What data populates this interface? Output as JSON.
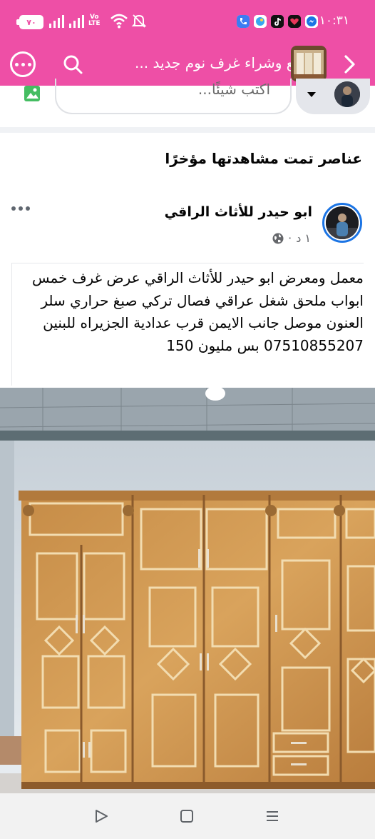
{
  "status_bar": {
    "time": "١٠:٣١",
    "battery": "٧٠",
    "network": "Vo LTE",
    "network_line1": "Vo",
    "network_line2": "LTE"
  },
  "app_bar": {
    "title": "بيع وشراء غرف نوم جديد ...",
    "more_icon": "more-horizontal-circle-icon",
    "search_icon": "search-icon",
    "back_icon": "chevron-right-icon"
  },
  "composer": {
    "placeholder": "اكتب شيئًا..."
  },
  "section": {
    "title": "عناصر تمت مشاهدتها مؤخرًا"
  },
  "post": {
    "author": "ابو حيدر للأثاث الراقي",
    "time": "١ د",
    "separator": "·",
    "text": "معمل ومعرض ابو حيدر للأثاث الراقي عرض غرف خمس ابواب ملحق شغل عراقي فصال تركي صبغ حراري سلر العنون موصل جانب الايمن قرب عدادية الجزيراه للبنين 07510855207 بس مليون 150"
  },
  "colors": {
    "accent": "#ee4fa6",
    "verified_ring": "#1b74e4",
    "photo_icon": "#45bd62"
  }
}
